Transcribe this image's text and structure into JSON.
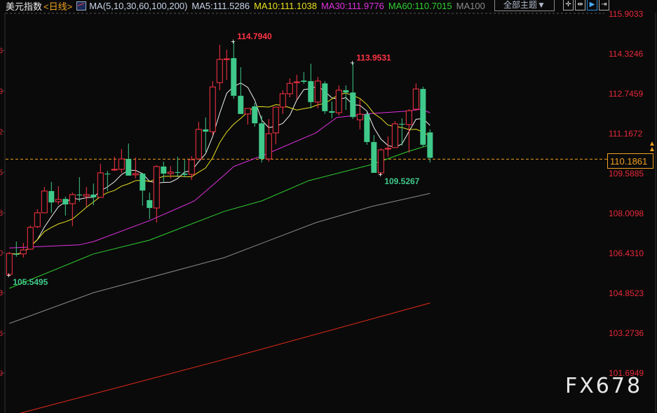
{
  "header": {
    "title": "美元指数",
    "period": "<日线>",
    "ma_params": "MA(5,10,30,60,100,200)",
    "ma5": "MA5:111.5286",
    "ma10": "MA10:111.1038",
    "ma30": "MA30:111.9776",
    "ma60": "MA60:110.7015",
    "ma100": "MA100",
    "theme_button": "全部主题▼",
    "tools": [
      {
        "name": "crosshair-icon",
        "glyph": "✛"
      },
      {
        "name": "range-icon",
        "glyph": "⇹"
      },
      {
        "name": "play-icon",
        "glyph": "▶"
      },
      {
        "name": "jump-end-icon",
        "glyph": "⇥"
      }
    ]
  },
  "colors": {
    "up": "#ff3344",
    "down": "#3fc98a",
    "ma5": "#f0f0f0",
    "ma10": "#e8e020",
    "ma30": "#e030e0",
    "ma60": "#30d030",
    "ma100": "#8a8a8a",
    "ma200": "#e82a1a",
    "axis_text": "#e8283a",
    "current": "#f0a020"
  },
  "current_price": "110.1861",
  "watermark": "FX678",
  "right_axis": [
    "115.9033",
    "114.3246",
    "112.7459",
    "111.1672",
    "109.5885",
    "108.0098",
    "106.4310",
    "104.8523",
    "103.2736",
    "101.6949"
  ],
  "left_axis_fragments": [
    "6",
    "9",
    "2",
    "5",
    "8",
    "0",
    "3",
    "6",
    "9"
  ],
  "annotations": [
    {
      "text": "114.7940",
      "type": "high",
      "index": 32,
      "price": 114.794
    },
    {
      "text": "113.9531",
      "type": "high",
      "index": 49,
      "price": 113.9531
    },
    {
      "text": "109.5267",
      "type": "low",
      "index": 53,
      "price": 109.5267
    },
    {
      "text": "105.5495",
      "type": "low",
      "index": 0,
      "price": 105.5495
    }
  ],
  "chart_data": {
    "type": "candlestick",
    "title": "美元指数 日线",
    "ylim": [
      101.25,
      116.43
    ],
    "ohlc": [
      [
        105.57,
        106.46,
        105.54,
        106.4
      ],
      [
        106.38,
        106.87,
        106.27,
        106.35
      ],
      [
        106.38,
        106.82,
        106.24,
        106.54
      ],
      [
        106.57,
        107.51,
        106.57,
        107.43
      ],
      [
        107.46,
        108.15,
        107.4,
        108.01
      ],
      [
        108.01,
        109.03,
        108.01,
        108.87
      ],
      [
        108.87,
        109.23,
        108.01,
        108.42
      ],
      [
        108.45,
        109.06,
        108.34,
        108.54
      ],
      [
        108.56,
        108.65,
        107.9,
        108.34
      ],
      [
        108.37,
        108.81,
        107.48,
        108.73
      ],
      [
        108.73,
        109.42,
        108.45,
        108.7
      ],
      [
        108.67,
        109.03,
        108.26,
        108.73
      ],
      [
        108.73,
        109.17,
        108.31,
        108.62
      ],
      [
        108.62,
        109.95,
        108.62,
        109.59
      ],
      [
        109.56,
        109.67,
        108.87,
        109.53
      ],
      [
        109.7,
        110.23,
        109.67,
        109.73
      ],
      [
        109.73,
        110.53,
        109.59,
        110.14
      ],
      [
        110.14,
        110.75,
        109.48,
        109.48
      ],
      [
        109.51,
        110.2,
        109.37,
        109.56
      ],
      [
        109.56,
        109.56,
        108.29,
        108.89
      ],
      [
        108.51,
        108.81,
        107.76,
        108.2
      ],
      [
        108.2,
        109.89,
        107.62,
        109.84
      ],
      [
        109.84,
        110.03,
        109.23,
        109.56
      ],
      [
        109.56,
        109.86,
        109.37,
        109.62
      ],
      [
        109.62,
        110.23,
        109.42,
        109.59
      ],
      [
        109.56,
        110.11,
        109.42,
        109.51
      ],
      [
        109.53,
        110.25,
        109.31,
        110.11
      ],
      [
        110.14,
        111.61,
        110.14,
        111.31
      ],
      [
        111.31,
        111.78,
        110.42,
        111.22
      ],
      [
        111.22,
        113.22,
        111.08,
        112.99
      ],
      [
        113.16,
        114.66,
        112.86,
        114.08
      ],
      [
        114.08,
        114.46,
        113.27,
        114.1
      ],
      [
        114.13,
        114.794,
        112.52,
        112.64
      ],
      [
        112.64,
        113.77,
        111.92,
        111.92
      ],
      [
        111.92,
        112.14,
        111.5,
        112.14
      ],
      [
        112.22,
        112.36,
        111.42,
        111.55
      ],
      [
        111.55,
        111.86,
        110.0,
        110.14
      ],
      [
        110.14,
        111.72,
        110.03,
        111.14
      ],
      [
        111.17,
        112.19,
        110.72,
        112.19
      ],
      [
        112.19,
        112.86,
        111.92,
        112.72
      ],
      [
        112.72,
        113.33,
        112.58,
        113.13
      ],
      [
        113.16,
        113.47,
        112.5,
        113.19
      ],
      [
        113.24,
        113.58,
        113.11,
        113.19
      ],
      [
        113.22,
        113.91,
        112.14,
        112.39
      ],
      [
        112.39,
        113.38,
        112.14,
        113.22
      ],
      [
        113.13,
        113.22,
        111.92,
        112.03
      ],
      [
        112.03,
        112.41,
        111.75,
        111.97
      ],
      [
        111.97,
        113.05,
        111.86,
        112.86
      ],
      [
        112.86,
        113.05,
        112.08,
        112.77
      ],
      [
        112.77,
        113.9531,
        111.72,
        111.8
      ],
      [
        111.69,
        112.5,
        111.31,
        111.91
      ],
      [
        111.91,
        112.0,
        110.7,
        110.81
      ],
      [
        110.81,
        111.08,
        109.59,
        109.59
      ],
      [
        109.59,
        110.56,
        109.5267,
        110.5
      ],
      [
        110.53,
        111.03,
        110.23,
        110.56
      ],
      [
        110.59,
        111.64,
        110.59,
        111.53
      ],
      [
        111.53,
        111.75,
        110.67,
        111.5
      ],
      [
        111.5,
        112.11,
        110.39,
        112.05
      ],
      [
        112.11,
        113.13,
        112.05,
        112.91
      ],
      [
        112.91,
        113.0,
        110.61,
        110.7
      ],
      [
        111.19,
        111.31,
        110.0,
        110.1861
      ]
    ],
    "ma_lines": [
      {
        "name": "MA30",
        "color_key": "ma30",
        "points": [
          [
            0,
            106.62
          ],
          [
            10,
            106.74
          ],
          [
            12,
            106.87
          ],
          [
            20,
            107.7
          ],
          [
            26.4,
            108.48
          ],
          [
            30.7,
            109.51
          ],
          [
            32,
            109.84
          ],
          [
            36.7,
            110.34
          ],
          [
            43.7,
            111.17
          ],
          [
            46.7,
            111.78
          ],
          [
            51.7,
            111.94
          ],
          [
            56.7,
            112.03
          ],
          [
            58.7,
            112.11
          ],
          [
            60,
            111.97
          ]
        ]
      },
      {
        "name": "MA60",
        "color_key": "ma60",
        "points": [
          [
            0,
            105.02
          ],
          [
            12,
            106.38
          ],
          [
            20,
            106.93
          ],
          [
            30.7,
            108.07
          ],
          [
            36,
            108.48
          ],
          [
            42.7,
            109.28
          ],
          [
            51.7,
            109.92
          ],
          [
            56.7,
            110.42
          ],
          [
            60,
            110.7
          ]
        ]
      },
      {
        "name": "MA100",
        "color_key": "ma100",
        "points": [
          [
            0,
            103.63
          ],
          [
            12,
            104.85
          ],
          [
            30.7,
            106.24
          ],
          [
            43.7,
            107.62
          ],
          [
            51.7,
            108.26
          ],
          [
            60,
            108.78
          ]
        ]
      },
      {
        "name": "MA200",
        "color_key": "ma200",
        "points": [
          [
            0,
            99.95
          ],
          [
            1.7,
            100.09
          ],
          [
            30,
            102.16
          ],
          [
            60,
            104.44
          ]
        ]
      }
    ],
    "computed_ma": [
      {
        "name": "MA5",
        "period": 5,
        "color_key": "ma5"
      },
      {
        "name": "MA10",
        "period": 10,
        "color_key": "ma10"
      }
    ]
  }
}
